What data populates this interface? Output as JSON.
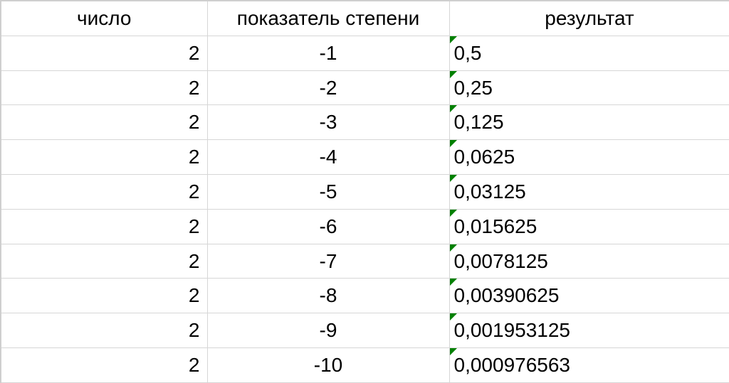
{
  "table": {
    "headers": {
      "number": "число",
      "exponent": "показатель степени",
      "result": "результат"
    },
    "rows": [
      {
        "number": "2",
        "exponent": "-1",
        "result": "0,5"
      },
      {
        "number": "2",
        "exponent": "-2",
        "result": "0,25"
      },
      {
        "number": "2",
        "exponent": "-3",
        "result": "0,125"
      },
      {
        "number": "2",
        "exponent": "-4",
        "result": "0,0625"
      },
      {
        "number": "2",
        "exponent": "-5",
        "result": "0,03125"
      },
      {
        "number": "2",
        "exponent": "-6",
        "result": "0,015625"
      },
      {
        "number": "2",
        "exponent": "-7",
        "result": "0,0078125"
      },
      {
        "number": "2",
        "exponent": "-8",
        "result": "0,00390625"
      },
      {
        "number": "2",
        "exponent": "-9",
        "result": "0,001953125"
      },
      {
        "number": "2",
        "exponent": "-10",
        "result": "0,000976563"
      }
    ]
  },
  "colors": {
    "gridline": "#d6d6d6",
    "errorFlag": "#008000"
  }
}
